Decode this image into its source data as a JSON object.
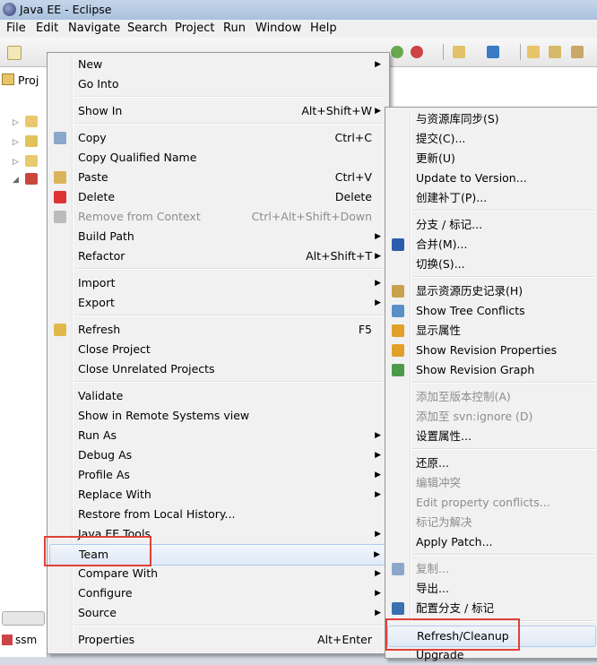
{
  "window": {
    "title": "Java EE - Eclipse"
  },
  "menubar": [
    "File",
    "Edit",
    "Navigate",
    "Search",
    "Project",
    "Run",
    "Window",
    "Help"
  ],
  "project_tab": "Proj",
  "bottom_tab": "ssm",
  "context_menu": {
    "items": [
      {
        "label": "New",
        "accel": "",
        "submenu": true,
        "icon": "",
        "disabled": false
      },
      {
        "label": "Go Into",
        "accel": "",
        "submenu": false,
        "icon": "",
        "disabled": false
      },
      {
        "label": "Show In",
        "accel": "Alt+Shift+W",
        "submenu": true,
        "icon": "",
        "disabled": false
      },
      {
        "label": "Copy",
        "accel": "Ctrl+C",
        "submenu": false,
        "icon": "copy-icon",
        "disabled": false
      },
      {
        "label": "Copy Qualified Name",
        "accel": "",
        "submenu": false,
        "icon": "",
        "disabled": false
      },
      {
        "label": "Paste",
        "accel": "Ctrl+V",
        "submenu": false,
        "icon": "paste-icon",
        "disabled": false
      },
      {
        "label": "Delete",
        "accel": "Delete",
        "submenu": false,
        "icon": "delete-icon",
        "disabled": false
      },
      {
        "label": "Remove from Context",
        "accel": "Ctrl+Alt+Shift+Down",
        "submenu": false,
        "icon": "remove-context-icon",
        "disabled": true
      },
      {
        "label": "Build Path",
        "accel": "",
        "submenu": true,
        "icon": "",
        "disabled": false
      },
      {
        "label": "Refactor",
        "accel": "Alt+Shift+T",
        "submenu": true,
        "icon": "",
        "disabled": false
      },
      {
        "label": "Import",
        "accel": "",
        "submenu": true,
        "icon": "",
        "disabled": false
      },
      {
        "label": "Export",
        "accel": "",
        "submenu": true,
        "icon": "",
        "disabled": false
      },
      {
        "label": "Refresh",
        "accel": "F5",
        "submenu": false,
        "icon": "refresh-icon",
        "disabled": false
      },
      {
        "label": "Close Project",
        "accel": "",
        "submenu": false,
        "icon": "",
        "disabled": false
      },
      {
        "label": "Close Unrelated Projects",
        "accel": "",
        "submenu": false,
        "icon": "",
        "disabled": false
      },
      {
        "label": "Validate",
        "accel": "",
        "submenu": false,
        "icon": "",
        "disabled": false
      },
      {
        "label": "Show in Remote Systems view",
        "accel": "",
        "submenu": false,
        "icon": "",
        "disabled": false
      },
      {
        "label": "Run As",
        "accel": "",
        "submenu": true,
        "icon": "",
        "disabled": false
      },
      {
        "label": "Debug As",
        "accel": "",
        "submenu": true,
        "icon": "",
        "disabled": false
      },
      {
        "label": "Profile As",
        "accel": "",
        "submenu": true,
        "icon": "",
        "disabled": false
      },
      {
        "label": "Replace With",
        "accel": "",
        "submenu": true,
        "icon": "",
        "disabled": false
      },
      {
        "label": "Restore from Local History...",
        "accel": "",
        "submenu": false,
        "icon": "",
        "disabled": false
      },
      {
        "label": "Java EE Tools",
        "accel": "",
        "submenu": true,
        "icon": "",
        "disabled": false
      },
      {
        "label": "Team",
        "accel": "",
        "submenu": true,
        "icon": "",
        "disabled": false
      },
      {
        "label": "Compare With",
        "accel": "",
        "submenu": true,
        "icon": "",
        "disabled": false
      },
      {
        "label": "Configure",
        "accel": "",
        "submenu": true,
        "icon": "",
        "disabled": false
      },
      {
        "label": "Source",
        "accel": "",
        "submenu": true,
        "icon": "",
        "disabled": false
      },
      {
        "label": "Properties",
        "accel": "Alt+Enter",
        "submenu": false,
        "icon": "",
        "disabled": false
      }
    ]
  },
  "team_menu": {
    "items": [
      {
        "label": "与资源库同步(S)",
        "icon": "",
        "disabled": false
      },
      {
        "label": "提交(C)...",
        "icon": "",
        "disabled": false
      },
      {
        "label": "更新(U)",
        "icon": "",
        "disabled": false
      },
      {
        "label": "Update to Version...",
        "icon": "",
        "disabled": false
      },
      {
        "label": "创建补丁(P)...",
        "icon": "",
        "disabled": false
      },
      {
        "label": "分支 / 标记...",
        "icon": "",
        "disabled": false
      },
      {
        "label": "合并(M)...",
        "icon": "merge-icon",
        "disabled": false
      },
      {
        "label": "切换(S)...",
        "icon": "",
        "disabled": false
      },
      {
        "label": "显示资源历史记录(H)",
        "icon": "history-icon",
        "disabled": false
      },
      {
        "label": "Show Tree Conflicts",
        "icon": "tree-conflicts-icon",
        "disabled": false
      },
      {
        "label": "显示属性",
        "icon": "properties-icon",
        "disabled": false
      },
      {
        "label": "Show Revision Properties",
        "icon": "revision-properties-icon",
        "disabled": false
      },
      {
        "label": "Show Revision Graph",
        "icon": "revision-graph-icon",
        "disabled": false
      },
      {
        "label": "添加至版本控制(A)",
        "icon": "",
        "disabled": true
      },
      {
        "label": "添加至 svn:ignore (D)",
        "icon": "",
        "disabled": true
      },
      {
        "label": "设置属性...",
        "icon": "",
        "disabled": false
      },
      {
        "label": "还原...",
        "icon": "",
        "disabled": false
      },
      {
        "label": "编辑冲突",
        "icon": "",
        "disabled": true
      },
      {
        "label": "Edit property conflicts...",
        "icon": "",
        "disabled": true
      },
      {
        "label": "标记为解决",
        "icon": "",
        "disabled": true
      },
      {
        "label": "Apply Patch...",
        "icon": "",
        "disabled": false
      },
      {
        "label": "复制...",
        "icon": "copy-icon",
        "disabled": true
      },
      {
        "label": "导出...",
        "icon": "",
        "disabled": false
      },
      {
        "label": "配置分支 / 标记",
        "icon": "configure-branches-icon",
        "disabled": false
      },
      {
        "label": "Refresh/Cleanup",
        "icon": "",
        "disabled": false
      },
      {
        "label": "Upgrade",
        "icon": "",
        "disabled": false
      }
    ]
  },
  "colors": {
    "highlight_box": "#e0413a",
    "menu_bg": "#f1f1f1",
    "hover_bg": "#dfe9f6"
  }
}
